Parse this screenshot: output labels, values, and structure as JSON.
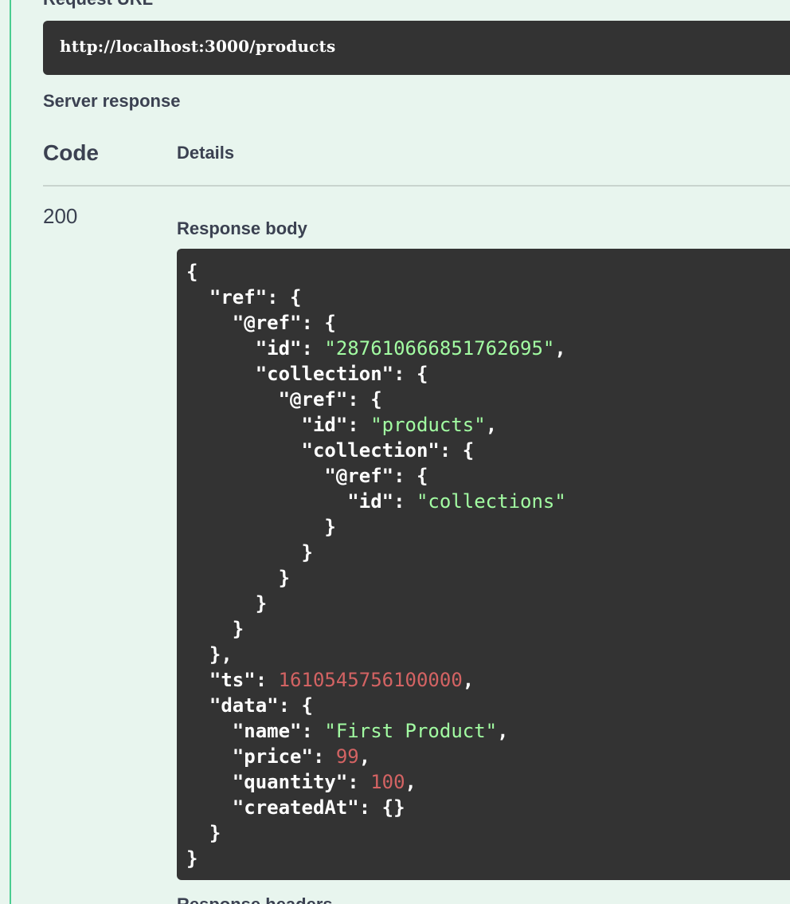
{
  "request": {
    "label": "Request URL",
    "url": "http://localhost:3000/products"
  },
  "server_response": {
    "label": "Server response",
    "columns": {
      "code": "Code",
      "details": "Details"
    },
    "status_code": "200",
    "response_body_label": "Response body",
    "response_headers_label": "Response headers"
  },
  "response_body": {
    "lines": [
      [
        {
          "t": "p",
          "v": "{"
        }
      ],
      [
        {
          "t": "p",
          "v": "  \"ref\": {"
        }
      ],
      [
        {
          "t": "p",
          "v": "    \"@ref\": {"
        }
      ],
      [
        {
          "t": "p",
          "v": "      \"id\": "
        },
        {
          "t": "s",
          "v": "\"287610666851762695\""
        },
        {
          "t": "p",
          "v": ","
        }
      ],
      [
        {
          "t": "p",
          "v": "      \"collection\": {"
        }
      ],
      [
        {
          "t": "p",
          "v": "        \"@ref\": {"
        }
      ],
      [
        {
          "t": "p",
          "v": "          \"id\": "
        },
        {
          "t": "s",
          "v": "\"products\""
        },
        {
          "t": "p",
          "v": ","
        }
      ],
      [
        {
          "t": "p",
          "v": "          \"collection\": {"
        }
      ],
      [
        {
          "t": "p",
          "v": "            \"@ref\": {"
        }
      ],
      [
        {
          "t": "p",
          "v": "              \"id\": "
        },
        {
          "t": "s",
          "v": "\"collections\""
        }
      ],
      [
        {
          "t": "p",
          "v": "            }"
        }
      ],
      [
        {
          "t": "p",
          "v": "          }"
        }
      ],
      [
        {
          "t": "p",
          "v": "        }"
        }
      ],
      [
        {
          "t": "p",
          "v": "      }"
        }
      ],
      [
        {
          "t": "p",
          "v": "    }"
        }
      ],
      [
        {
          "t": "p",
          "v": "  },"
        }
      ],
      [
        {
          "t": "p",
          "v": "  \"ts\": "
        },
        {
          "t": "n",
          "v": "1610545756100000"
        },
        {
          "t": "p",
          "v": ","
        }
      ],
      [
        {
          "t": "p",
          "v": "  \"data\": {"
        }
      ],
      [
        {
          "t": "p",
          "v": "    \"name\": "
        },
        {
          "t": "s",
          "v": "\"First Product\""
        },
        {
          "t": "p",
          "v": ","
        }
      ],
      [
        {
          "t": "p",
          "v": "    \"price\": "
        },
        {
          "t": "n",
          "v": "99"
        },
        {
          "t": "p",
          "v": ","
        }
      ],
      [
        {
          "t": "p",
          "v": "    \"quantity\": "
        },
        {
          "t": "n",
          "v": "100"
        },
        {
          "t": "p",
          "v": ","
        }
      ],
      [
        {
          "t": "p",
          "v": "    \"createdAt\": {}"
        }
      ],
      [
        {
          "t": "p",
          "v": "  }"
        }
      ],
      [
        {
          "t": "p",
          "v": "}"
        }
      ]
    ]
  },
  "colors": {
    "background": "#e8f5ee",
    "accent_border": "#49cc90",
    "code_background": "#333333",
    "string": "#a2fca2",
    "number": "#d36363"
  }
}
